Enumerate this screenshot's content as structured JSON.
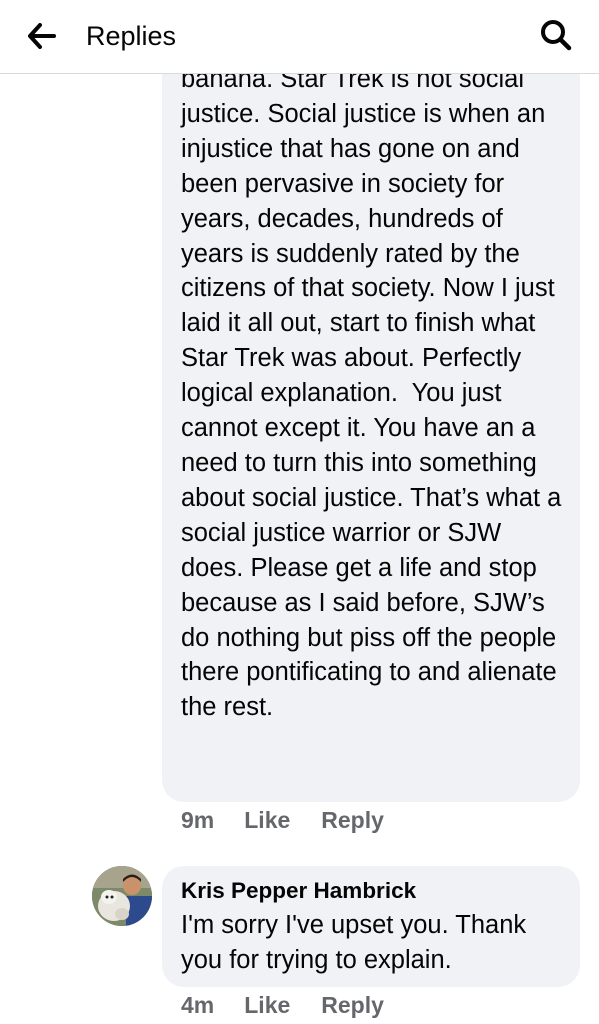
{
  "header": {
    "title": "Replies",
    "back_icon": "arrow-left-icon",
    "search_icon": "search-icon"
  },
  "comments": [
    {
      "text": "banana. Star Trek is not social justice. Social justice is when an injustice that has gone on and been pervasive in society for years, decades, hundreds of years is suddenly rated by the citizens of that society. Now I just laid it all out, start to finish what Star Trek was about. Perfectly logical explanation.  You just cannot except it. You have an a need to turn this into something about social justice. That’s what a social justice warrior or SJW does. Please get a life and stop because as I said before, SJW’s do nothing but piss off the people there pontificating to and alienate the rest.",
      "time": "9m",
      "like_label": "Like",
      "reply_label": "Reply"
    },
    {
      "author": "Kris Pepper Hambrick",
      "text": "I'm sorry I've upset you. Thank you for trying to explain.",
      "time": "4m",
      "like_label": "Like",
      "reply_label": "Reply"
    }
  ],
  "colors": {
    "bubble": "#f0f2f5",
    "meta": "#65676b",
    "text": "#050505"
  }
}
